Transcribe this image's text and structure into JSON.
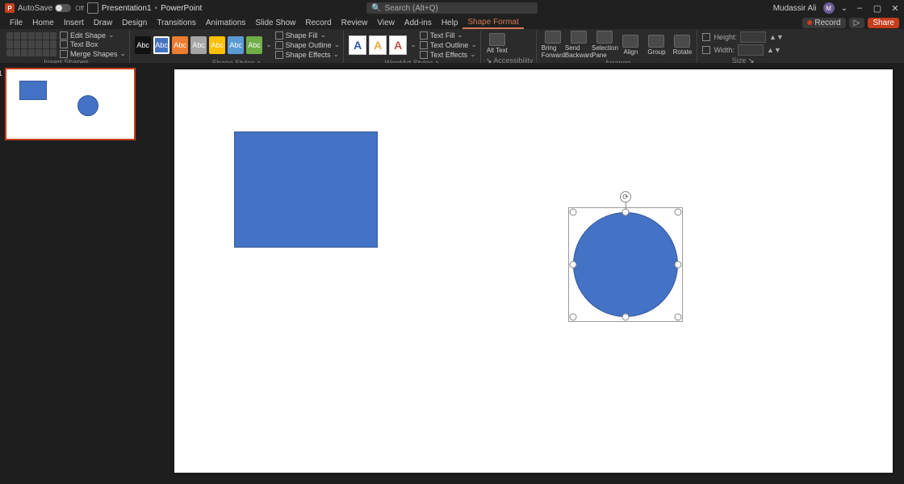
{
  "title": {
    "autosave_label": "AutoSave",
    "autosave_state": "Off",
    "doc_name": "Presentation1",
    "app_name": "PowerPoint",
    "search_placeholder": "Search (Alt+Q)",
    "user_name": "Mudassir Ali"
  },
  "window_controls": {
    "minimize": "–",
    "restore": "▢",
    "close": "✕"
  },
  "menutabs": {
    "file": "File",
    "home": "Home",
    "insert": "Insert",
    "draw": "Draw",
    "design": "Design",
    "transitions": "Transitions",
    "animations": "Animations",
    "slideshow": "Slide Show",
    "record": "Record",
    "review": "Review",
    "view": "View",
    "addins": "Add-ins",
    "help": "Help",
    "shapeformat": "Shape Format"
  },
  "topright": {
    "record": "Record",
    "present": "▷",
    "share": "Share"
  },
  "ribbon": {
    "insert_shapes": {
      "edit_shape": "Edit Shape",
      "text_box": "Text Box",
      "merge_shapes": "Merge Shapes",
      "label": "Insert Shapes"
    },
    "shape_styles": {
      "sample": "Abc",
      "shape_fill": "Shape Fill",
      "shape_outline": "Shape Outline",
      "shape_effects": "Shape Effects",
      "label": "Shape Styles"
    },
    "wordart": {
      "glyph": "A",
      "text_fill": "Text Fill",
      "text_outline": "Text Outline",
      "text_effects": "Text Effects",
      "label": "WordArt Styles"
    },
    "accessibility": {
      "alt_text": "Alt Text",
      "label": "Accessibility"
    },
    "arrange": {
      "bring_forward": "Bring Forward",
      "send_backward": "Send Backward",
      "selection_pane": "Selection Pane",
      "align": "Align",
      "group": "Group",
      "rotate": "Rotate",
      "label": "Arrange"
    },
    "size": {
      "height_label": "Height:",
      "height_value": "",
      "width_label": "Width:",
      "width_value": "",
      "label": "Size"
    }
  },
  "thumb": {
    "number": "1"
  },
  "colors": {
    "shape_fill": "#4472c4",
    "shape_border": "#355a9e",
    "accent": "#c43e1c"
  }
}
